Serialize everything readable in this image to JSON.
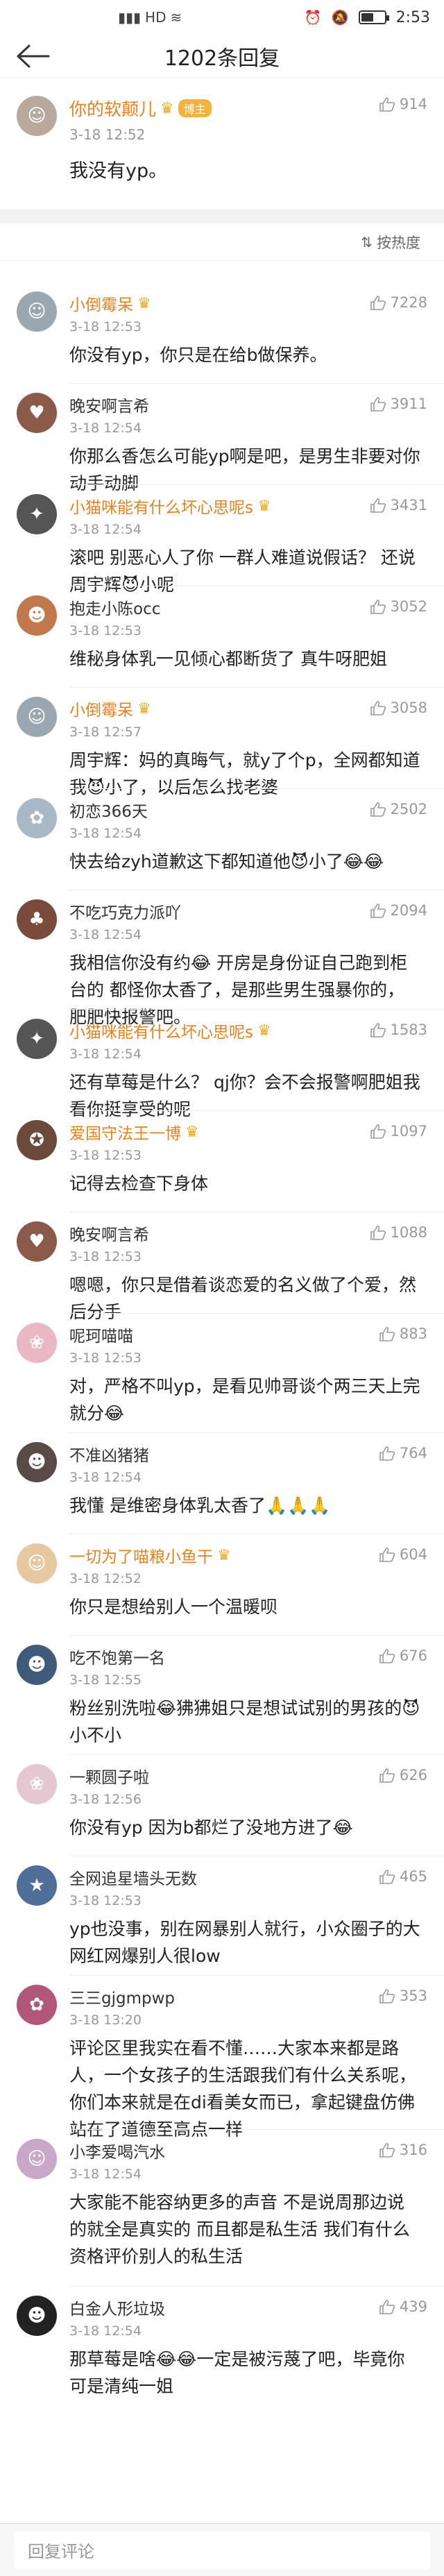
{
  "status_bar": {
    "time": "2:53",
    "icons": [
      "signal-icon",
      "hd-icon",
      "wifi-icon",
      "alarm-icon",
      "mute-icon",
      "battery-icon"
    ],
    "battery_level": 0.55
  },
  "header": {
    "title": "1202条回复"
  },
  "original": {
    "name": "你的软颠儿",
    "badge": "博主",
    "time": "3-18 12:52",
    "likes": "914",
    "text": "我没有yp。"
  },
  "sort": {
    "label": "按热度"
  },
  "comments": [
    {
      "name": "小倒霉呆",
      "vip": true,
      "crown": true,
      "time": "3-18 12:53",
      "likes": "7228",
      "text": "你没有yp，你只是在给b做保养。",
      "avatar_color": "#9aa6b0",
      "avatar_glyph": "☺"
    },
    {
      "name": "晚安啊言希",
      "vip": false,
      "crown": false,
      "time": "3-18 12:54",
      "likes": "3911",
      "text": "你那么香怎么可能yp啊是吧，是男生非要对你动手动脚",
      "avatar_color": "#8b5a4a",
      "avatar_glyph": "♥"
    },
    {
      "name": "小猫咪能有什么坏心思呢s",
      "vip": true,
      "crown": true,
      "time": "3-18 12:54",
      "likes": "3431",
      "text": "滚吧 别恶心人了你 一群人难道说假话？ 还说周宇辉😈小呢",
      "avatar_color": "#555",
      "avatar_glyph": "✦"
    },
    {
      "name": "抱走小陈occ",
      "vip": false,
      "crown": false,
      "time": "3-18 12:53",
      "likes": "3052",
      "text": "维秘身体乳一见倾心都断货了 真牛呀肥姐",
      "avatar_color": "#c2784d",
      "avatar_glyph": "☻"
    },
    {
      "name": "小倒霉呆",
      "vip": true,
      "crown": true,
      "time": "3-18 12:57",
      "likes": "3058",
      "text": "周宇辉：妈的真晦气，就y了个p，全网都知道我😈小了，以后怎么找老婆",
      "avatar_color": "#9aa6b0",
      "avatar_glyph": "☺"
    },
    {
      "name": "初恋366天",
      "vip": false,
      "crown": false,
      "time": "3-18 12:54",
      "likes": "2502",
      "text": "快去给zyh道歉这下都知道他😈小了😂😂",
      "avatar_color": "#a9b8c6",
      "avatar_glyph": "✿"
    },
    {
      "name": "不吃巧克力派吖",
      "vip": false,
      "crown": false,
      "time": "3-18 12:54",
      "likes": "2094",
      "text": "我相信你没有约😂 开房是身份证自己跑到柜台的 都怪你太香了，是那些男生强暴你的，肥肥快报警吧。",
      "avatar_color": "#7a4a3a",
      "avatar_glyph": "♣"
    },
    {
      "name": "小猫咪能有什么坏心思呢s",
      "vip": true,
      "crown": true,
      "time": "3-18 12:54",
      "likes": "1583",
      "text": "还有草莓是什么？ qj你？会不会报警啊肥姐我看你挺享受的呢",
      "avatar_color": "#555",
      "avatar_glyph": "✦"
    },
    {
      "name": "爱国守法王一博",
      "vip": true,
      "crown": true,
      "time": "3-18 12:53",
      "likes": "1097",
      "text": "记得去检查下身体",
      "avatar_color": "#6b4a3c",
      "avatar_glyph": "✪"
    },
    {
      "name": "晚安啊言希",
      "vip": false,
      "crown": false,
      "time": "3-18 12:53",
      "likes": "1088",
      "text": "嗯嗯，你只是借着谈恋爱的名义做了个爱，然后分手",
      "avatar_color": "#8b5a4a",
      "avatar_glyph": "♥"
    },
    {
      "name": "呢珂喵喵",
      "vip": false,
      "crown": false,
      "time": "3-18 12:53",
      "likes": "883",
      "text": "对，严格不叫yp，是看见帅哥谈个两三天上完就分😂",
      "avatar_color": "#e9b8c4",
      "avatar_glyph": "❀"
    },
    {
      "name": "不准凶猪猪",
      "vip": false,
      "crown": false,
      "time": "3-18 12:54",
      "likes": "764",
      "text": "我懂 是维密身体乳太香了🙏🙏🙏",
      "avatar_color": "#5a4a48",
      "avatar_glyph": "☻"
    },
    {
      "name": "一切为了喵粮小鱼干",
      "vip": true,
      "crown": true,
      "time": "3-18 12:52",
      "likes": "604",
      "text": "你只是想给别人一个温暖呗",
      "avatar_color": "#e6c9a0",
      "avatar_glyph": "☺"
    },
    {
      "name": "吃不饱第一名",
      "vip": false,
      "crown": false,
      "time": "3-18 12:55",
      "likes": "676",
      "text": "粉丝别洗啦😂狒狒姐只是想试试别的男孩的😈小不小",
      "avatar_color": "#3f5a7a",
      "avatar_glyph": "☻"
    },
    {
      "name": "一颗圆子啦",
      "vip": false,
      "crown": false,
      "time": "3-18 12:56",
      "likes": "626",
      "text": "你没有yp 因为b都烂了没地方进了😂",
      "avatar_color": "#e4c7d0",
      "avatar_glyph": "❀"
    },
    {
      "name": "全网追星墙头无数",
      "vip": false,
      "crown": false,
      "time": "3-18 12:53",
      "likes": "465",
      "text": "yp也没事，别在网暴别人就行，小众圈子的大网红网爆别人很low",
      "avatar_color": "#4f6f9a",
      "avatar_glyph": "★"
    },
    {
      "name": "三三gjgmpwp",
      "vip": false,
      "crown": false,
      "time": "3-18 13:20",
      "likes": "353",
      "text": "评论区里我实在看不懂……大家本来都是路人，一个女孩子的生活跟我们有什么关系呢，你们本来就是在di看美女而已，拿起键盘仿佛站在了道德至高点一样",
      "avatar_color": "#b2567a",
      "avatar_glyph": "✿"
    },
    {
      "name": "小李爱喝汽水",
      "vip": false,
      "crown": false,
      "time": "3-18 12:54",
      "likes": "316",
      "text": "大家能不能容纳更多的声音 不是说周那边说的就全是真实的 而且都是私生活 我们有什么资格评价别人的私生活",
      "avatar_color": "#c9a7c9",
      "avatar_glyph": "☺"
    },
    {
      "name": "白金人形垃圾",
      "vip": false,
      "crown": false,
      "time": "3-18 12:54",
      "likes": "439",
      "text": "那草莓是啥😂😂一定是被污蔑了吧，毕竟你可是清纯一姐",
      "avatar_color": "#222",
      "avatar_glyph": "☻"
    }
  ],
  "bottom_bar": {
    "placeholder": "回复评论"
  }
}
